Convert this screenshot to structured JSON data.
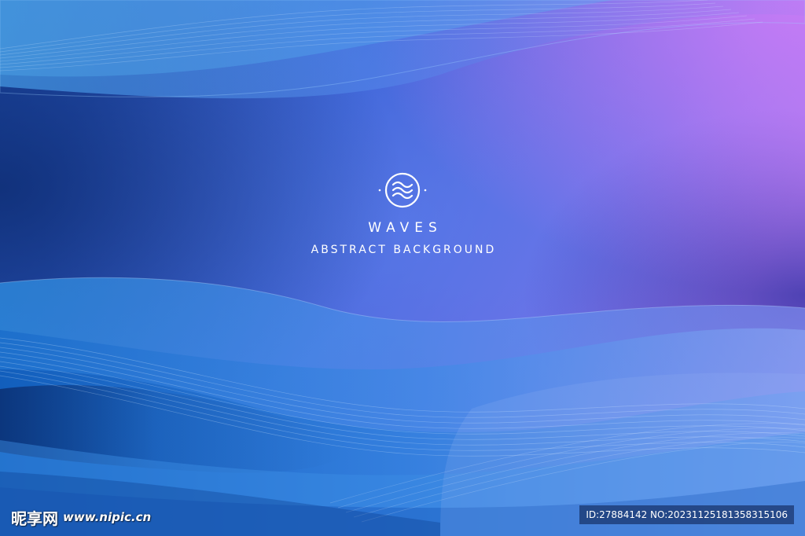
{
  "artwork": {
    "title": "WAVES",
    "subtitle": "ABSTRACT BACKGROUND",
    "emblem_icon": "waves-icon",
    "colors": {
      "deep_blue": "#1b3f9a",
      "mid_blue": "#3a73d6",
      "cyan": "#4fa8ec",
      "violet": "#7b74ea",
      "magenta_glow": "#c07af5",
      "text": "#ffffff"
    }
  },
  "watermark": {
    "brand": "昵享网",
    "url": "www.nipic.cn",
    "id_text": "ID:27884142 NO:20231125181358315106"
  }
}
